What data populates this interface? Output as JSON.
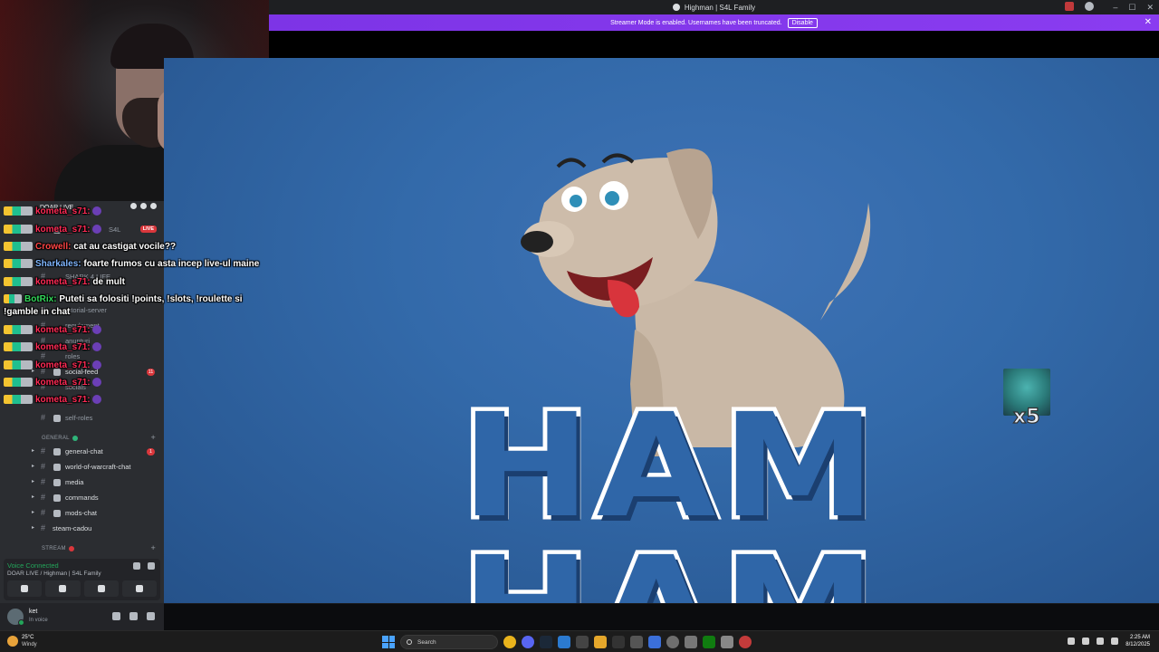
{
  "window": {
    "title": "Highman | S4L Family",
    "controls": [
      "–",
      "☐",
      "✕"
    ]
  },
  "banner": {
    "message": "Streamer Mode is enabled. Usernames have been truncated.",
    "button": "Disable",
    "close": "✕"
  },
  "stream": {
    "title": "HAM HAM",
    "emote_count": "x5"
  },
  "guild": {
    "header": "DOAR LIVE",
    "channels": [
      {
        "name": "S4L",
        "live": "LIVE"
      },
      {
        "name": "SHARK 4 LIFE"
      },
      {
        "name": "tutorial-server"
      },
      {
        "name": "regulament"
      },
      {
        "name": "anunturi"
      },
      {
        "name": "roles"
      },
      {
        "name": "social-feed",
        "badge": "11"
      },
      {
        "name": "socials"
      },
      {
        "name": "self-roles"
      }
    ],
    "category_general": "GENERAL",
    "general_channels": [
      {
        "name": "general-chat",
        "badge": "1"
      },
      {
        "name": "world-of-warcraft-chat"
      },
      {
        "name": "media"
      },
      {
        "name": "commands"
      },
      {
        "name": "mods-chat"
      },
      {
        "name": "steam-cadou"
      }
    ],
    "category_stream": "STREAM"
  },
  "voice": {
    "status": "Voice Connected",
    "channel": "DOAR LIVE / Highman | S4L Family"
  },
  "user": {
    "name": "ket",
    "status": "In voice"
  },
  "chat": [
    {
      "user": "kometa_s71:",
      "class": "kom",
      "text": ""
    },
    {
      "user": "kometa_s71:",
      "class": "kom",
      "text": ""
    },
    {
      "user": "Crowell:",
      "class": "crow",
      "text": "cat au castigat vocile??"
    },
    {
      "user": "Sharkales:",
      "class": "shark",
      "text": "foarte frumos cu asta incep live-ul maine"
    },
    {
      "user": "kometa_s71:",
      "class": "kom",
      "text": "de mult"
    },
    {
      "user": "BotRix:",
      "class": "bot",
      "text": "Puteti sa folositi !points, !slots, !roulette si"
    },
    {
      "user": "",
      "class": "bot",
      "text": "!gamble in chat"
    },
    {
      "user": "kometa_s71:",
      "class": "kom",
      "text": ""
    },
    {
      "user": "kometa_s71:",
      "class": "kom",
      "text": ""
    },
    {
      "user": "kometa_s71:",
      "class": "kom",
      "text": ""
    },
    {
      "user": "kometa_s71:",
      "class": "kom",
      "text": ""
    },
    {
      "user": "kometa_s71:",
      "class": "kom",
      "text": ""
    }
  ],
  "taskbar": {
    "temp": "25°C",
    "weather": "Windy",
    "search": "Search",
    "time": "2:25 AM",
    "date": "8/12/2025"
  }
}
